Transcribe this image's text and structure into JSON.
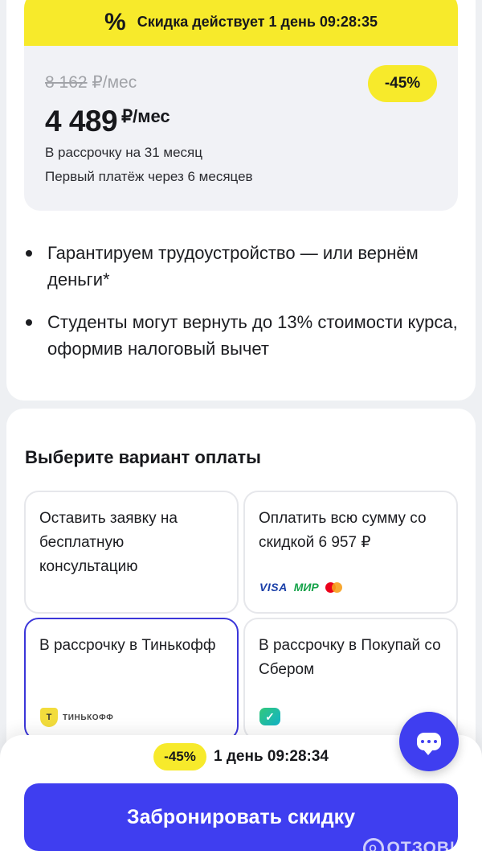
{
  "promo": {
    "timer_label": "Скидка действует 1 день 09:28:35",
    "old_price": "8 162",
    "old_price_unit": "₽/мес",
    "discount_badge": "-45%",
    "new_price": "4 489",
    "new_price_unit": "₽/мес",
    "installment": "В рассрочку на 31 месяц",
    "first_payment": "Первый платёж через 6 месяцев"
  },
  "benefits": [
    "Гарантируем трудоустройство — или вернём деньги*",
    "Студенты могут вернуть до 13% стоимости курса, оформив налоговый вычет"
  ],
  "payment": {
    "title": "Выберите вариант оплаты",
    "options": [
      {
        "label": "Оставить заявку на бесплатную консультацию",
        "selected": false
      },
      {
        "label": "Оплатить всю сумму со скидкой 6 957 ₽",
        "selected": false,
        "logos": [
          "visa",
          "mir",
          "mastercard"
        ]
      },
      {
        "label": "В рассрочку в Тинькофф",
        "selected": true,
        "logo": "tinkoff"
      },
      {
        "label": "В рассрочку в Покупай со Сбером",
        "selected": false,
        "logo": "sber"
      }
    ],
    "logo_text": {
      "visa": "VISA",
      "mir": "МИР",
      "tinkoff": "ТИНЬКОФФ"
    }
  },
  "footer": {
    "badge": "-45%",
    "timer": "1 день 09:28:34",
    "book_button": "Забронировать скидку"
  },
  "watermark": "ОТЗОВИК",
  "colors": {
    "accent": "#3f3ef0",
    "yellow": "#f7ea2b",
    "selected_border": "#3b36d9"
  }
}
